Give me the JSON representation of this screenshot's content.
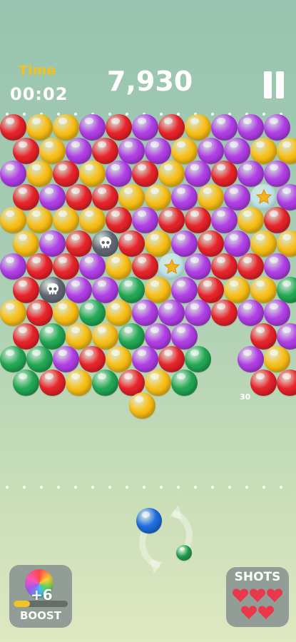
{
  "hud": {
    "time_label": "Time",
    "time_value": "00:02",
    "score": "7,930"
  },
  "colors": {
    "red": "#e8232a",
    "yellow": "#f9bf16",
    "purple": "#b13ee6",
    "green": "#22a854",
    "blue": "#1c6ee0",
    "skull": "#5d6470",
    "star": "#bfe3e8"
  },
  "board_rows": [
    "R Y Y P R P R Y P P P",
    "R Y P R P P Y P P Y Y",
    "P Y R Y P R Y P R P P",
    "R P R R Y Y P Y P S P",
    "Y Y Y Y R P R R P Y R",
    "Y P R K R Y P R P Y Y",
    "P R R P Y R S P R R P",
    "R K P P G Y P R Y Y G",
    "Y R Y G Y P P P R P P",
    "R G Y Y G P P . . R P",
    "G G P R Y P R G . P Y",
    "G R Y G R Y G . . R R",
    ". . . . . Y . . . . ."
  ],
  "floating_points": "30",
  "current_bubble": "blue",
  "next_bubble": "green",
  "boost": {
    "bonus": "+6",
    "label": "BOOST",
    "progress": 0.3
  },
  "shots": {
    "label": "SHOTS",
    "hearts": 5
  }
}
